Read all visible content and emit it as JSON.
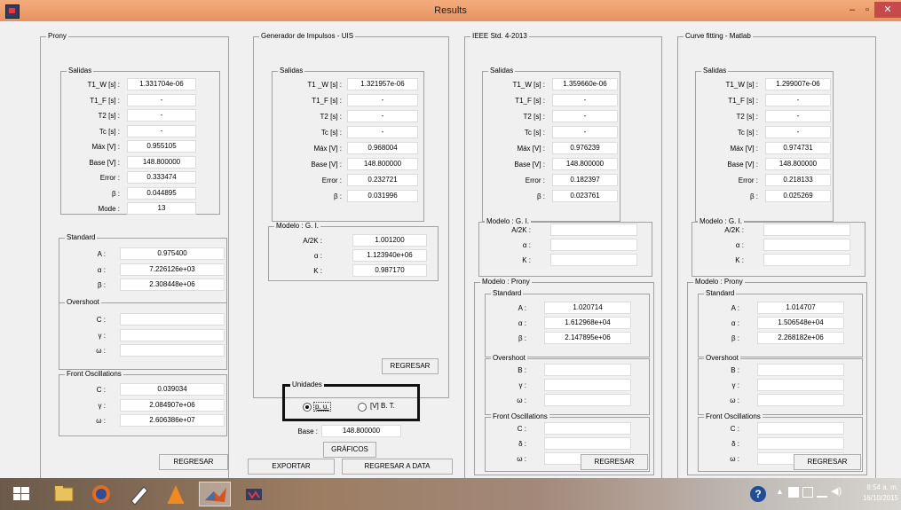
{
  "window": {
    "title": "Results",
    "minimize": "–",
    "restore": "▫",
    "close": "✕"
  },
  "panels": {
    "prony": {
      "title": "Prony",
      "salidas": {
        "title": "Salidas",
        "rows": [
          {
            "label": "T1_W [s] :",
            "value": "1.331704e-06"
          },
          {
            "label": "T1_F [s] :",
            "value": "-"
          },
          {
            "label": "T2 [s] :",
            "value": "-"
          },
          {
            "label": "Tc [s] :",
            "value": "-"
          },
          {
            "label": "Máx [V] :",
            "value": "0.955105"
          },
          {
            "label": "Base [V] :",
            "value": "148.800000"
          },
          {
            "label": "Error :",
            "value": "0.333474"
          },
          {
            "label": "β :",
            "value": "0.044895"
          },
          {
            "label": "Mode :",
            "value": "13"
          }
        ]
      },
      "standard": {
        "title": "Standard",
        "rows": [
          {
            "label": "A :",
            "value": "0.975400"
          },
          {
            "label": "α :",
            "value": "7.226126e+03"
          },
          {
            "label": "β :",
            "value": "2.308448e+06"
          }
        ]
      },
      "overshoot": {
        "title": "Overshoot",
        "rows": [
          {
            "label": "C :",
            "value": ""
          },
          {
            "label": "γ :",
            "value": ""
          },
          {
            "label": "ω :",
            "value": ""
          }
        ]
      },
      "front": {
        "title": "Front Oscillations",
        "rows": [
          {
            "label": "C :",
            "value": "0.039034"
          },
          {
            "label": "γ :",
            "value": "2.084907e+06"
          },
          {
            "label": "ω :",
            "value": "2.606386e+07"
          }
        ]
      },
      "regresar": "REGRESAR"
    },
    "generador": {
      "title": "Generador de Impulsos - UIS",
      "salidas": {
        "title": "Salidas",
        "rows": [
          {
            "label": "T1 _W [s] :",
            "value": "1.321957e-06"
          },
          {
            "label": "T1_F [s] :",
            "value": "-"
          },
          {
            "label": "T2 [s] :",
            "value": "-"
          },
          {
            "label": "Tc [s] :",
            "value": "-"
          },
          {
            "label": "Máx [V] :",
            "value": "0.968004"
          },
          {
            "label": "Base [V] :",
            "value": "148.800000"
          },
          {
            "label": "Error :",
            "value": "0.232721"
          },
          {
            "label": "β :",
            "value": "0.031996"
          }
        ]
      },
      "modelo": {
        "title": "Modelo : G. I.",
        "rows": [
          {
            "label": "A/2K :",
            "value": "1.001200"
          },
          {
            "label": "α :",
            "value": "1.123940e+06"
          },
          {
            "label": "K :",
            "value": "0.987170"
          }
        ]
      },
      "regresar": "REGRESAR"
    },
    "ieee": {
      "title": "IEEE Std. 4-2013",
      "salidas": {
        "title": "Salidas",
        "rows": [
          {
            "label": "T1_W [s] :",
            "value": "1.359660e-06"
          },
          {
            "label": "T1_F [s] :",
            "value": "-"
          },
          {
            "label": "T2 [s] :",
            "value": "-"
          },
          {
            "label": "Tc [s] :",
            "value": "-"
          },
          {
            "label": "Máx [V] :",
            "value": "0.976239"
          },
          {
            "label": "Base [V] :",
            "value": "148.800000"
          },
          {
            "label": "Error :",
            "value": "0.182397"
          },
          {
            "label": "β :",
            "value": "0.023761"
          }
        ]
      },
      "modelo_gi": {
        "title": "Modelo : G. I.",
        "rows": [
          {
            "label": "A/2K :",
            "value": ""
          },
          {
            "label": "α :",
            "value": ""
          },
          {
            "label": "K :",
            "value": ""
          }
        ]
      },
      "modelo_prony": {
        "title": "Modelo : Prony"
      },
      "standard": {
        "title": "Standard",
        "rows": [
          {
            "label": "A :",
            "value": "1.020714"
          },
          {
            "label": "α :",
            "value": "1.612968e+04"
          },
          {
            "label": "β :",
            "value": "2.147895e+06"
          }
        ]
      },
      "overshoot": {
        "title": "Overshoot",
        "rows": [
          {
            "label": "B :",
            "value": ""
          },
          {
            "label": "γ :",
            "value": ""
          },
          {
            "label": "ω :",
            "value": ""
          }
        ]
      },
      "front": {
        "title": "Front Oscillations",
        "rows": [
          {
            "label": "C :",
            "value": ""
          },
          {
            "label": "δ :",
            "value": ""
          },
          {
            "label": "ω :",
            "value": ""
          }
        ]
      },
      "regresar": "REGRESAR"
    },
    "curve": {
      "title": "Curve fitting - Matlab",
      "salidas": {
        "title": "Salidas",
        "rows": [
          {
            "label": "T1_W [s] :",
            "value": "1.299007e-06"
          },
          {
            "label": "T1_F [s] :",
            "value": "-"
          },
          {
            "label": "T2 [s] :",
            "value": "-"
          },
          {
            "label": "Tc [s] :",
            "value": "-"
          },
          {
            "label": "Máx [V] :",
            "value": "0.974731"
          },
          {
            "label": "Base [V] :",
            "value": "148.800000"
          },
          {
            "label": "Error :",
            "value": "0.218133"
          },
          {
            "label": "β :",
            "value": "0.025269"
          }
        ]
      },
      "modelo_gi": {
        "title": "Modelo : G. I.",
        "rows": [
          {
            "label": "A/2K :",
            "value": ""
          },
          {
            "label": "α :",
            "value": ""
          },
          {
            "label": "K :",
            "value": ""
          }
        ]
      },
      "modelo_prony": {
        "title": "Modelo : Prony"
      },
      "standard": {
        "title": "Standard",
        "rows": [
          {
            "label": "A :",
            "value": "1.014707"
          },
          {
            "label": "α :",
            "value": "1.506548e+04"
          },
          {
            "label": "β :",
            "value": "2.268182e+06"
          }
        ]
      },
      "overshoot": {
        "title": "Overshoot",
        "rows": [
          {
            "label": "B :",
            "value": ""
          },
          {
            "label": "γ :",
            "value": ""
          },
          {
            "label": "ω :",
            "value": ""
          }
        ]
      },
      "front": {
        "title": "Front Oscillations",
        "rows": [
          {
            "label": "C :",
            "value": ""
          },
          {
            "label": "δ :",
            "value": ""
          },
          {
            "label": "ω :",
            "value": ""
          }
        ]
      },
      "regresar": "REGRESAR"
    }
  },
  "unidades": {
    "title": "Unidades",
    "pu": "p. u.",
    "vbt": "[V] B. T.",
    "selected": "pu"
  },
  "base": {
    "label": "Base :",
    "value": "148.800000"
  },
  "buttons": {
    "graficos": "GRÁFICOS",
    "exportar": "EXPORTAR",
    "regresar_data": "REGRESAR A DATA"
  },
  "taskbar": {
    "time": "8:54 a. m.",
    "date": "16/10/2015"
  }
}
